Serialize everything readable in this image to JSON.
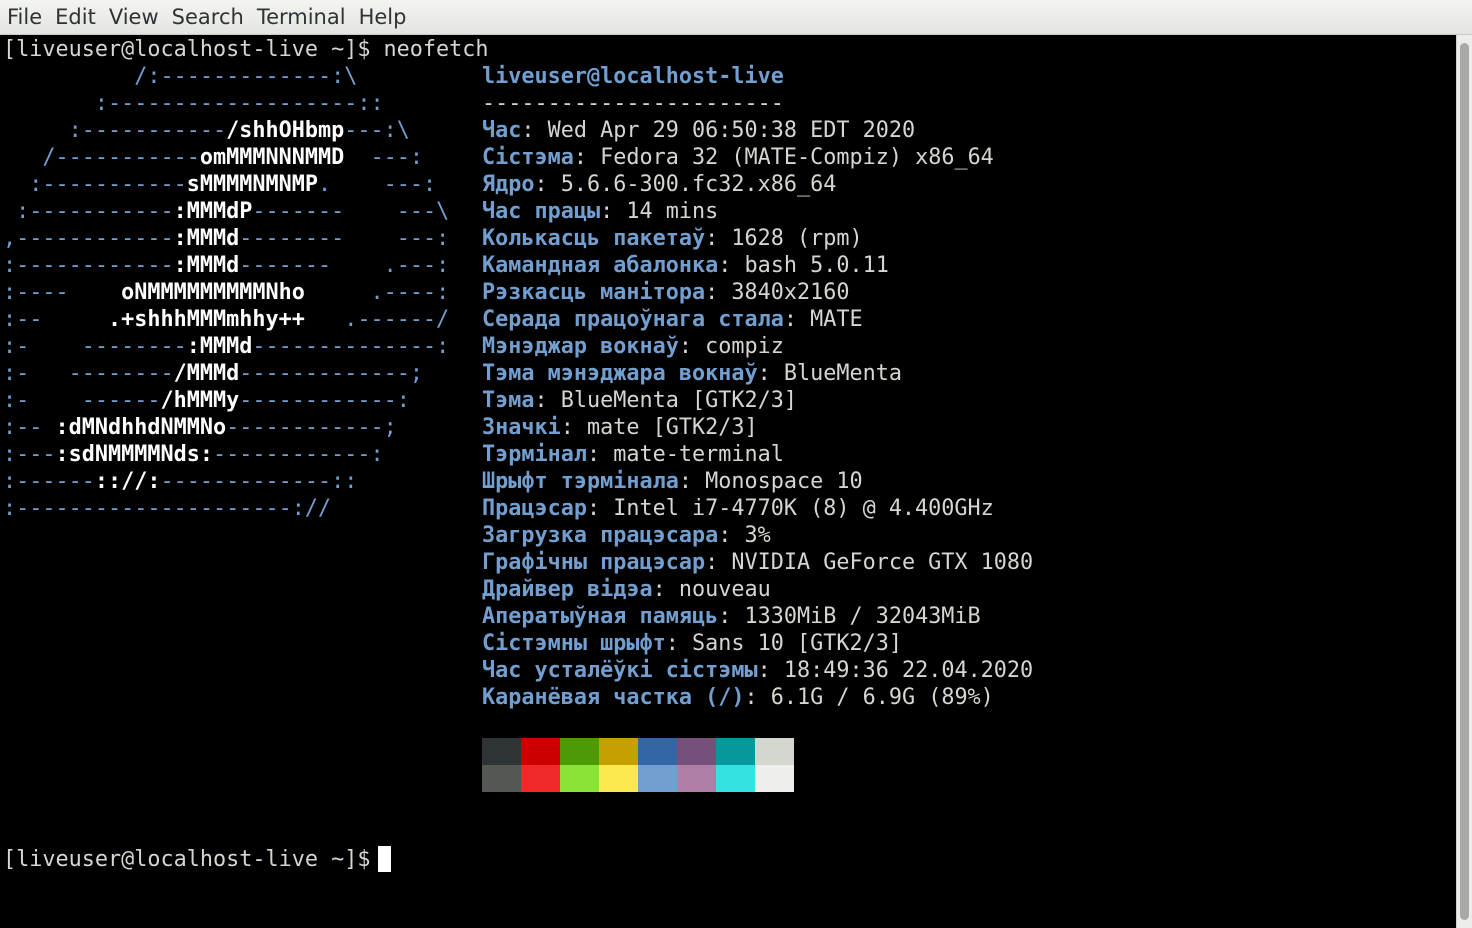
{
  "menubar": {
    "items": [
      "File",
      "Edit",
      "View",
      "Search",
      "Terminal",
      "Help"
    ]
  },
  "terminal": {
    "command_line": "[liveuser@localhost-live ~]$ neofetch",
    "prompt_line": "[liveuser@localhost-live ~]$ ",
    "logo": [
      [
        "          /:-------------:\\",
        "",
        ""
      ],
      [
        "       :-------------------::",
        "",
        ""
      ],
      [
        "     :-----------",
        "/shhOHbmp",
        "---:\\"
      ],
      [
        "   /-----------",
        "omMMMNNNMMD",
        "  ---:"
      ],
      [
        "  :-----------",
        "sMMMMNMNMP",
        ".    ---:"
      ],
      [
        " :-----------",
        ":MMMdP",
        "-------    ---\\"
      ],
      [
        ",------------",
        ":MMMd",
        "--------    ---:"
      ],
      [
        ":------------",
        ":MMMd",
        "-------    .---:"
      ],
      [
        ":----    ",
        "oNMMMMMMMMMNho",
        "     .----:"
      ],
      [
        ":--     ",
        ".+shhhMMMmhhy++",
        "   .------/"
      ],
      [
        ":-    --------",
        ":MMMd",
        "--------------:"
      ],
      [
        ":-   --------",
        "/MMMd",
        "-------------;"
      ],
      [
        ":-    ------",
        "/hMMMy",
        "------------:"
      ],
      [
        ":-- ",
        ":dMNdhhdNMMNo",
        "------------;"
      ],
      [
        ":---",
        ":sdNMMMMNds:",
        "------------:"
      ],
      [
        ":------",
        ":://:",
        "-------------::"
      ],
      [
        ":---------------------://",
        "",
        ""
      ]
    ],
    "user_host": "liveuser@localhost-live",
    "separator": "-----------------------",
    "info": [
      {
        "key": "Час",
        "value": "Wed Apr 29 06:50:38 EDT 2020"
      },
      {
        "key": "Сістэма",
        "value": "Fedora 32 (MATE-Compiz) x86_64"
      },
      {
        "key": "Ядро",
        "value": "5.6.6-300.fc32.x86_64"
      },
      {
        "key": "Час працы",
        "value": "14 mins"
      },
      {
        "key": "Колькасць пакетаў",
        "value": "1628 (rpm)"
      },
      {
        "key": "Камандная абалонка",
        "value": "bash 5.0.11"
      },
      {
        "key": "Рэзкасць манітора",
        "value": "3840x2160"
      },
      {
        "key": "Серада працоўнага стала",
        "value": "MATE"
      },
      {
        "key": "Мэнэджар вокнаў",
        "value": "compiz"
      },
      {
        "key": "Тэма мэнэджара вокнаў",
        "value": "BlueMenta"
      },
      {
        "key": "Тэма",
        "value": "BlueMenta [GTK2/3]"
      },
      {
        "key": "Значкі",
        "value": "mate [GTK2/3]"
      },
      {
        "key": "Тэрмінал",
        "value": "mate-terminal"
      },
      {
        "key": "Шрыфт тэрмінала",
        "value": "Monospace 10"
      },
      {
        "key": "Працэсар",
        "value": "Intel i7-4770K (8) @ 4.400GHz"
      },
      {
        "key": "Загрузка працэсара",
        "value": "3%"
      },
      {
        "key": "Графічны працэсар",
        "value": "NVIDIA GeForce GTX 1080"
      },
      {
        "key": "Драйвер відэа",
        "value": "nouveau"
      },
      {
        "key": "Аператыўная памяць",
        "value": "1330MiB / 32043MiB"
      },
      {
        "key": "Сістэмны шрыфт",
        "value": "Sans 10 [GTK2/3]"
      },
      {
        "key": "Час усталёўкі сістэмы",
        "value": "18:49:36 22.04.2020"
      },
      {
        "key": "Каранёвая частка (/)",
        "value": "6.1G / 6.9G (89%)"
      }
    ],
    "palette": {
      "normal": [
        "#2e3436",
        "#cc0000",
        "#4e9a06",
        "#c4a000",
        "#3465a4",
        "#75507b",
        "#06989a",
        "#d3d7cf"
      ],
      "bright": [
        "#555753",
        "#ef2929",
        "#8ae234",
        "#fce94f",
        "#729fcf",
        "#ad7fa8",
        "#34e2e2",
        "#eeeeec"
      ]
    }
  }
}
